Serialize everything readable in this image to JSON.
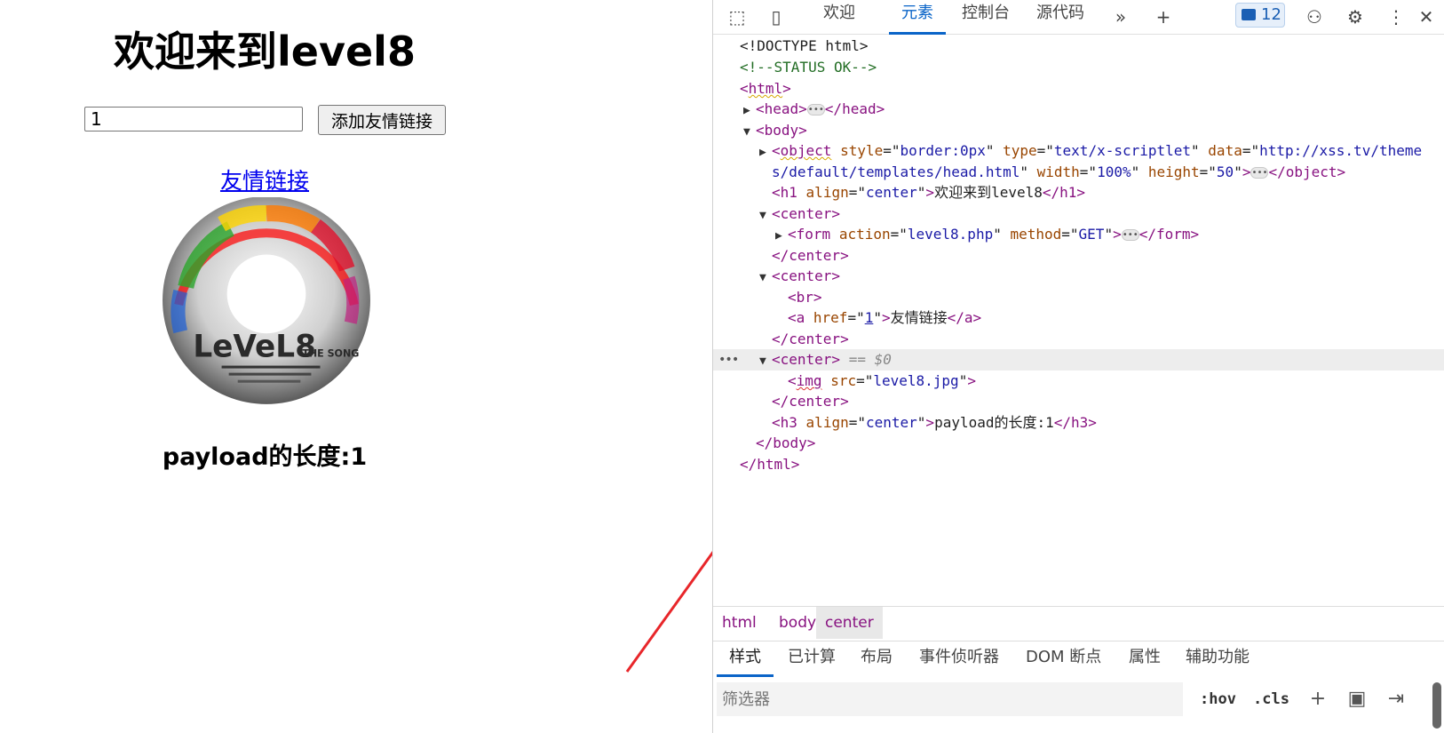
{
  "page": {
    "heading": "欢迎来到level8",
    "input_value": "1",
    "submit_label": "添加友情链接",
    "link_text": "友情链接",
    "image_text": "LeVeL8",
    "image_subtext": "THE SONG",
    "payload_text": "payload的长度:1"
  },
  "devtools": {
    "tabs": [
      "欢迎",
      "元素",
      "控制台",
      "源代码"
    ],
    "issues_count": "12",
    "dom": {
      "doctype": "<!DOCTYPE html>",
      "comment": "<!--STATUS OK-->",
      "object_style": "border:0px",
      "object_type": "text/x-scriptlet",
      "object_data_1": "http://xss.tv/theme",
      "object_data_2": "s/default/templates/head.html",
      "object_width": "100%",
      "object_height": "50",
      "h1_align": "center",
      "h1_text": "欢迎来到level8",
      "form_action": "level8.php",
      "form_method": "GET",
      "a_href": "1",
      "a_text": "友情链接",
      "img_src": "level8.jpg",
      "h3_align": "center",
      "h3_text": "payload的长度:1",
      "selected_marker": "== $0"
    },
    "breadcrumbs": [
      "html",
      "body",
      "center"
    ],
    "subtabs": [
      "样式",
      "已计算",
      "布局",
      "事件侦听器",
      "DOM 断点",
      "属性",
      "辅助功能"
    ],
    "filter_placeholder": "筛选器",
    "filter_buttons": [
      ":hov",
      ".cls"
    ]
  },
  "colors": {
    "link": "#0000ee",
    "accent": "#0a64c8",
    "arrow": "#e8262a"
  }
}
